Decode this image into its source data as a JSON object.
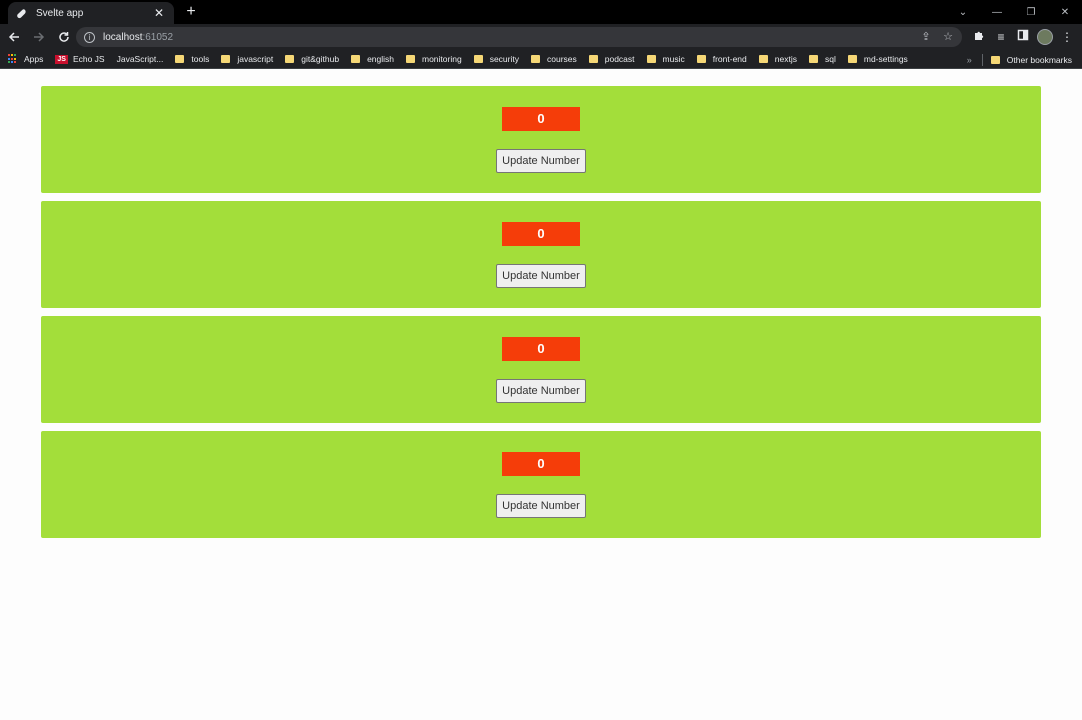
{
  "browser": {
    "tab_title": "Svelte app",
    "tab_close": "✕",
    "new_tab": "+",
    "url_host": "localhost",
    "url_port": ":61052",
    "icons": [
      "back-arrow-icon",
      "forward-arrow-icon",
      "reload-icon",
      "info-icon",
      "share-icon",
      "star-icon",
      "extensions-icon",
      "media-icon",
      "side-panel-icon",
      "profile-avatar",
      "menu-icon"
    ]
  },
  "bookmarks": {
    "items": [
      {
        "label": "Apps",
        "icon": "apps-grid-icon"
      },
      {
        "label": "Echo JS",
        "icon": "js-badge-icon",
        "badge": "JS"
      },
      {
        "label": "JavaScript...",
        "icon": "none"
      },
      {
        "label": "tools",
        "icon": "folder-icon"
      },
      {
        "label": "javascript",
        "icon": "folder-icon"
      },
      {
        "label": "git&github",
        "icon": "folder-icon"
      },
      {
        "label": "english",
        "icon": "folder-icon"
      },
      {
        "label": "monitoring",
        "icon": "folder-icon"
      },
      {
        "label": "security",
        "icon": "folder-icon"
      },
      {
        "label": "courses",
        "icon": "folder-icon"
      },
      {
        "label": "podcast",
        "icon": "folder-icon"
      },
      {
        "label": "music",
        "icon": "folder-icon"
      },
      {
        "label": "front-end",
        "icon": "folder-icon"
      },
      {
        "label": "nextjs",
        "icon": "folder-icon"
      },
      {
        "label": "sql",
        "icon": "folder-icon"
      },
      {
        "label": "md-settings",
        "icon": "folder-icon"
      }
    ],
    "overflow": "»",
    "other_bookmarks": "Other bookmarks"
  },
  "page": {
    "colors": {
      "background": "#fdfdfd",
      "card": "#a3de3a",
      "number_box": "#f53d09",
      "number_text": "#ffffff"
    },
    "cards": [
      {
        "number": "0",
        "button_label": "Update Number"
      },
      {
        "number": "0",
        "button_label": "Update Number"
      },
      {
        "number": "0",
        "button_label": "Update Number"
      },
      {
        "number": "0",
        "button_label": "Update Number"
      }
    ]
  }
}
